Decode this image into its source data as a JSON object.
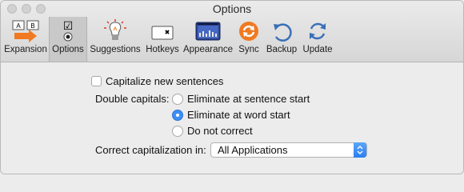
{
  "window": {
    "title": "Options"
  },
  "toolbar": {
    "items": [
      {
        "label": "Expansion"
      },
      {
        "label": "Options"
      },
      {
        "label": "Suggestions"
      },
      {
        "label": "Hotkeys"
      },
      {
        "label": "Appearance"
      },
      {
        "label": "Sync"
      },
      {
        "label": "Backup"
      },
      {
        "label": "Update"
      }
    ],
    "active": "Options",
    "icons": [
      "expansion-icon",
      "options-icon",
      "lightbulb-icon",
      "hotkey-icon",
      "appearance-icon",
      "sync-icon",
      "backup-icon",
      "update-icon"
    ],
    "hotkey_glyph": "✖",
    "expansion_keys": [
      "A",
      "B"
    ],
    "options_check": "☑"
  },
  "options": {
    "capitalize_new_sentences": {
      "label": "Capitalize new sentences",
      "checked": false
    },
    "double_capitals": {
      "label": "Double capitals:",
      "choices": [
        {
          "label": "Eliminate at sentence start",
          "selected": false
        },
        {
          "label": "Eliminate at word start",
          "selected": true
        },
        {
          "label": "Do not correct",
          "selected": false
        }
      ]
    },
    "correct_capitalization": {
      "label": "Correct capitalization in:",
      "value": "All Applications"
    }
  },
  "colors": {
    "accent": "#3d8ff7",
    "orange": "#f07a22",
    "sync_blue": "#3a6fb7"
  }
}
